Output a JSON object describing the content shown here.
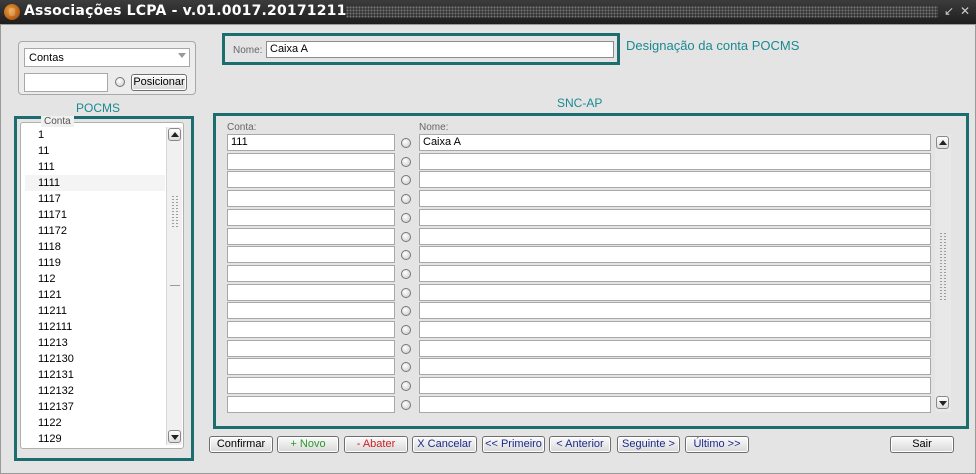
{
  "window": {
    "title": "Associações LCPA - v.01.0017.20171211"
  },
  "filter": {
    "select_value": "Contas",
    "position_value": "",
    "position_button": "Posicionar"
  },
  "pocms": {
    "section_label": "POCMS",
    "group_label": "Conta",
    "items": [
      "1",
      "11",
      "111",
      "1111",
      "1117",
      "11171",
      "11172",
      "1118",
      "1119",
      "112",
      "1121",
      "11211",
      "112111",
      "11213",
      "112130",
      "112131",
      "112132",
      "112137",
      "1122",
      "1129"
    ]
  },
  "nome_field": {
    "label": "Nome:",
    "value": "Caixa A",
    "description": "Designação da conta POCMS"
  },
  "snc": {
    "section_label": "SNC-AP",
    "col_conta": "Conta:",
    "col_nome": "Nome:",
    "rows": [
      {
        "conta": "111",
        "nome": "Caixa A"
      },
      {
        "conta": "",
        "nome": ""
      },
      {
        "conta": "",
        "nome": ""
      },
      {
        "conta": "",
        "nome": ""
      },
      {
        "conta": "",
        "nome": ""
      },
      {
        "conta": "",
        "nome": ""
      },
      {
        "conta": "",
        "nome": ""
      },
      {
        "conta": "",
        "nome": ""
      },
      {
        "conta": "",
        "nome": ""
      },
      {
        "conta": "",
        "nome": ""
      },
      {
        "conta": "",
        "nome": ""
      },
      {
        "conta": "",
        "nome": ""
      },
      {
        "conta": "",
        "nome": ""
      },
      {
        "conta": "",
        "nome": ""
      },
      {
        "conta": "",
        "nome": ""
      }
    ]
  },
  "buttons": {
    "confirmar": "Confirmar",
    "novo": "+ Novo",
    "abater": "- Abater",
    "cancelar": "X Cancelar",
    "primeiro": "<< Primeiro",
    "anterior": "< Anterior",
    "seguinte": "Seguinte >",
    "ultimo": "Último >>",
    "sair": "Sair"
  },
  "colors": {
    "accent_teal": "#1b6d70",
    "label_teal": "#1a8a90",
    "novo_green": "#2a9a2a",
    "abater_red": "#cc2020",
    "nav_blue": "#1a2a8a"
  }
}
